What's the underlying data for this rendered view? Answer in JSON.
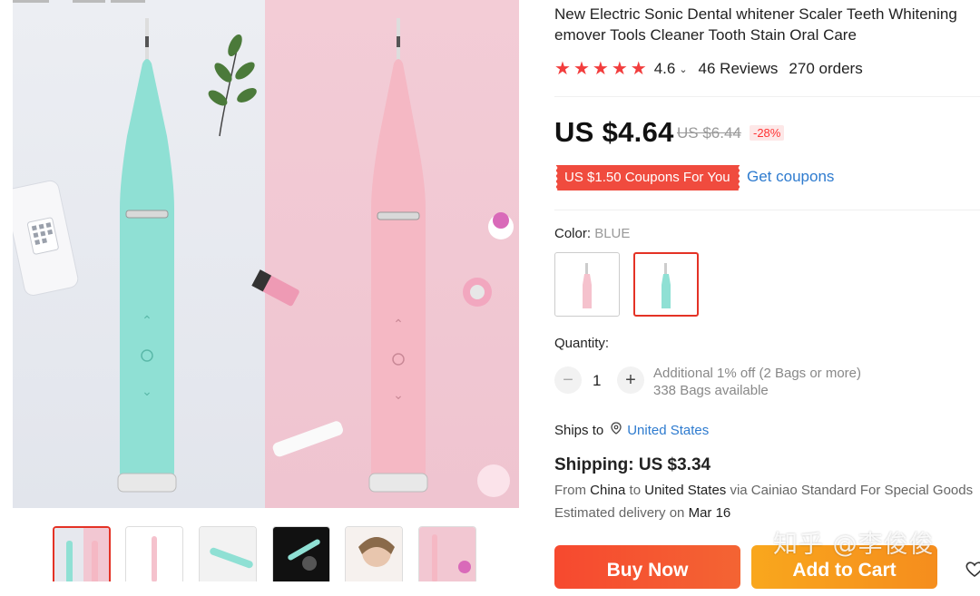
{
  "product": {
    "title_line1": "New Electric Sonic Dental whitener Scaler Teeth Whitening",
    "title_line2": "emover Tools Cleaner Tooth Stain Oral Care",
    "rating": "4.6",
    "rating_stars": 5,
    "reviews": "46 Reviews",
    "orders": "270 orders"
  },
  "price": {
    "current": "US $4.64",
    "original": "US $6.44",
    "discount": "-28%"
  },
  "coupon": {
    "badge": "US $1.50 Coupons For You",
    "link": "Get coupons"
  },
  "color": {
    "label": "Color:",
    "value": "BLUE",
    "options": [
      "pink",
      "blue"
    ],
    "selected": "blue"
  },
  "quantity": {
    "label": "Quantity:",
    "value": "1",
    "minus": "−",
    "plus": "+",
    "info_line1": "Additional 1% off (2 Bags or more)",
    "info_line2": "338 Bags available"
  },
  "ships": {
    "label": "Ships to",
    "country": "United States"
  },
  "shipping": {
    "title": "Shipping: US $3.34",
    "from_prefix": "From",
    "from_country": "China",
    "to_word": "to",
    "to_country": "United States",
    "via_text": "via Cainiao Standard For Special Goods",
    "delivery_prefix": "Estimated delivery on",
    "delivery_date": "Mar 16"
  },
  "actions": {
    "buy_now": "Buy Now",
    "add_to_cart": "Add to Cart"
  },
  "watermark": "知乎 @李俊俊",
  "colors": {
    "accent_red": "#e43225",
    "link_blue": "#2e7bcf",
    "star_red": "#f23d3d",
    "buy_orange_red": "#f6492f",
    "cart_orange": "#f9a71d",
    "mint": "#8fe0d4",
    "pink": "#f5b8c4"
  }
}
